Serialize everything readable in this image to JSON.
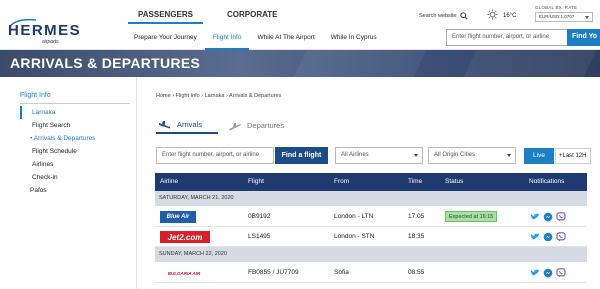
{
  "brand": {
    "name": "HERMES",
    "sub": "airports",
    "color": "#1e3a6e"
  },
  "mainnav": {
    "passengers": "PASSENGERS",
    "corporate": "CORPORATE"
  },
  "utility": {
    "search_website": "Search website",
    "temperature": "16°C",
    "rate_label": "GLOBAL EX. RATE",
    "rate_value": "EUR/USD:1.0707"
  },
  "subnav": {
    "items": [
      "Prepare Your Journey",
      "Flight Info",
      "While At The Airport",
      "While In Cyprus"
    ],
    "active": "Flight Info"
  },
  "top_search": {
    "placeholder": "Enter flight number, airport, or airline",
    "button": "Find Yo"
  },
  "hero": {
    "title": "ARRIVALS & DEPARTURES"
  },
  "sidebar": {
    "title": "Flight Info",
    "items": [
      "Larnaka",
      "Flight Search",
      "Arrivals & Departures",
      "Flight Schedule",
      "Airlines",
      "Check-in",
      "Pafos"
    ]
  },
  "breadcrumb": "Home  ›  Flight Info  ›  Larnaka  ›  Arrivals & Departures",
  "tabs": {
    "arrivals": "Arrivals",
    "departures": "Departures"
  },
  "filters": {
    "search_placeholder": "Enter flight number, airport, or airline",
    "find_button": "Find a flight",
    "airlines_value": "All Airlines",
    "cities_value": "All Origin Cities",
    "live": "Live",
    "last": "+Last 12H"
  },
  "table": {
    "headers": [
      "Airline",
      "Flight",
      "From",
      "Time",
      "Status",
      "Notifications"
    ],
    "days": [
      {
        "label": "SATURDAY, MARCH 21, 2020",
        "flights": [
          {
            "airline": "Blue Air",
            "flight": "0B9192",
            "from": "London - LTN",
            "time": "17:05",
            "status": "Expected at 16:15"
          },
          {
            "airline": "Jet2.com",
            "flight": "LS1495",
            "from": "London - STN",
            "time": "18:35",
            "status": ""
          }
        ]
      },
      {
        "label": "SUNDAY, MARCH 22, 2020",
        "flights": [
          {
            "airline": "BULGARIA AIR",
            "flight": "FB0855 / JU7709",
            "from": "Sofia",
            "time": "08:55",
            "status": ""
          }
        ]
      }
    ]
  },
  "colors": {
    "accent": "#1c7fc3",
    "navy": "#1e3a6e",
    "status_green": "#a8e0a5"
  }
}
